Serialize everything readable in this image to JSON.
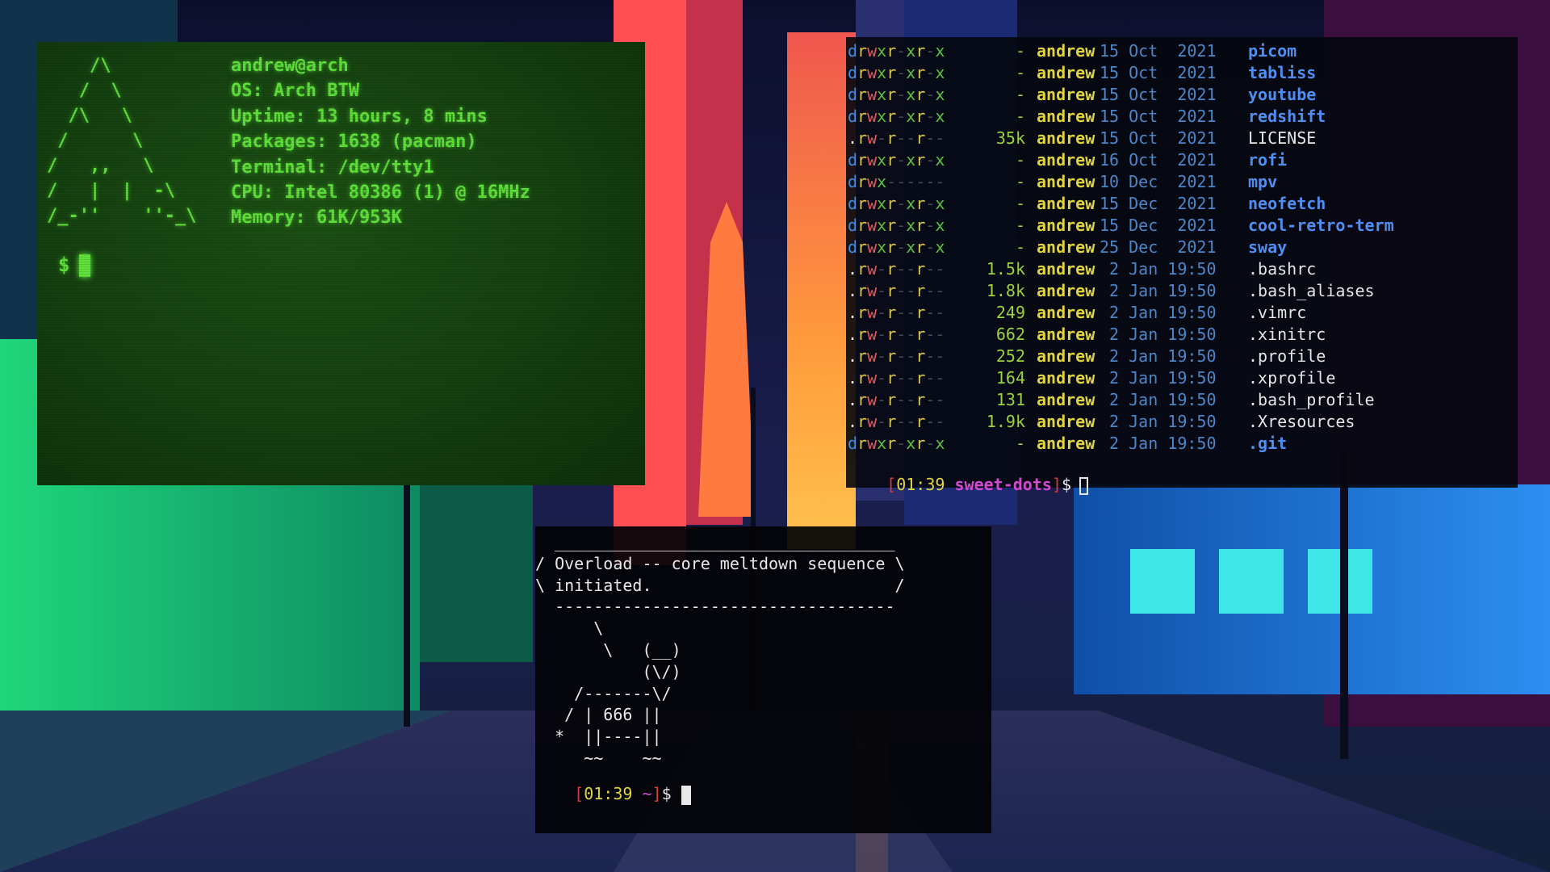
{
  "colors": {
    "retro_green": "#5fe03a",
    "ls_dir": "#4f8ff2",
    "ls_user": "#e1d53f",
    "ls_date": "#4b86c9",
    "prompt_bracket": "#d23c3c",
    "prompt_dir": "#d24ad2"
  },
  "neofetch": {
    "logo": "    /\\\n   /  \\\n  /\\   \\\n /      \\\n/   ,,   \\\n/   |  |  -\\\n/_-''    ''-_\\",
    "user_host": "andrew@arch",
    "os": "OS: Arch BTW",
    "uptime": "Uptime: 13 hours, 8 mins",
    "packages": "Packages: 1638 (pacman)",
    "terminal": "Terminal: /dev/tty1",
    "cpu": "CPU: Intel 80386 (1) @ 16MHz",
    "memory": "Memory: 61K/953K",
    "prompt": "$"
  },
  "ls_listing": {
    "rows": [
      {
        "perms": "drwxr-xr-x",
        "size": "-",
        "user": "andrew",
        "date": "15 Oct  2021",
        "name": "picom",
        "kind": "dir"
      },
      {
        "perms": "drwxr-xr-x",
        "size": "-",
        "user": "andrew",
        "date": "15 Oct  2021",
        "name": "tabliss",
        "kind": "dir"
      },
      {
        "perms": "drwxr-xr-x",
        "size": "-",
        "user": "andrew",
        "date": "15 Oct  2021",
        "name": "youtube",
        "kind": "dir"
      },
      {
        "perms": "drwxr-xr-x",
        "size": "-",
        "user": "andrew",
        "date": "15 Oct  2021",
        "name": "redshift",
        "kind": "dir"
      },
      {
        "perms": ".rw-r--r--",
        "size": "35k",
        "user": "andrew",
        "date": "15 Oct  2021",
        "name": "LICENSE",
        "kind": "file"
      },
      {
        "perms": "drwxr-xr-x",
        "size": "-",
        "user": "andrew",
        "date": "16 Oct  2021",
        "name": "rofi",
        "kind": "dir"
      },
      {
        "perms": "drwx------",
        "size": "-",
        "user": "andrew",
        "date": "10 Dec  2021",
        "name": "mpv",
        "kind": "dir"
      },
      {
        "perms": "drwxr-xr-x",
        "size": "-",
        "user": "andrew",
        "date": "15 Dec  2021",
        "name": "neofetch",
        "kind": "dir"
      },
      {
        "perms": "drwxr-xr-x",
        "size": "-",
        "user": "andrew",
        "date": "15 Dec  2021",
        "name": "cool-retro-term",
        "kind": "dir"
      },
      {
        "perms": "drwxr-xr-x",
        "size": "-",
        "user": "andrew",
        "date": "25 Dec  2021",
        "name": "sway",
        "kind": "dir"
      },
      {
        "perms": ".rw-r--r--",
        "size": "1.5k",
        "user": "andrew",
        "date": " 2 Jan 19:50",
        "name": ".bashrc",
        "kind": "file"
      },
      {
        "perms": ".rw-r--r--",
        "size": "1.8k",
        "user": "andrew",
        "date": " 2 Jan 19:50",
        "name": ".bash_aliases",
        "kind": "file"
      },
      {
        "perms": ".rw-r--r--",
        "size": "249",
        "user": "andrew",
        "date": " 2 Jan 19:50",
        "name": ".vimrc",
        "kind": "file"
      },
      {
        "perms": ".rw-r--r--",
        "size": "662",
        "user": "andrew",
        "date": " 2 Jan 19:50",
        "name": ".xinitrc",
        "kind": "file"
      },
      {
        "perms": ".rw-r--r--",
        "size": "252",
        "user": "andrew",
        "date": " 2 Jan 19:50",
        "name": ".profile",
        "kind": "file"
      },
      {
        "perms": ".rw-r--r--",
        "size": "164",
        "user": "andrew",
        "date": " 2 Jan 19:50",
        "name": ".xprofile",
        "kind": "file"
      },
      {
        "perms": ".rw-r--r--",
        "size": "131",
        "user": "andrew",
        "date": " 2 Jan 19:50",
        "name": ".bash_profile",
        "kind": "file"
      },
      {
        "perms": ".rw-r--r--",
        "size": "1.9k",
        "user": "andrew",
        "date": " 2 Jan 19:50",
        "name": ".Xresources",
        "kind": "file"
      },
      {
        "perms": "drwxr-xr-x",
        "size": "-",
        "user": "andrew",
        "date": " 2 Jan 19:50",
        "name": ".git",
        "kind": "dir"
      }
    ],
    "prompt": {
      "open": "[",
      "time": "01:39",
      "dir": "sweet-dots",
      "close": "]",
      "symbol": "$"
    }
  },
  "cowsay": {
    "art": "  ___________________________________\n/ Overload -- core meltdown sequence \\\n\\ initiated.                         /\n  -----------------------------------\n      \\\n       \\   (__)\n           (\\/)\n    /-------\\/\n   / | 666 ||\n  *  ||----||\n     ~~    ~~",
    "prompt": {
      "open": "[",
      "time": "01:39",
      "dir": "~",
      "close": "]",
      "symbol": "$"
    }
  }
}
